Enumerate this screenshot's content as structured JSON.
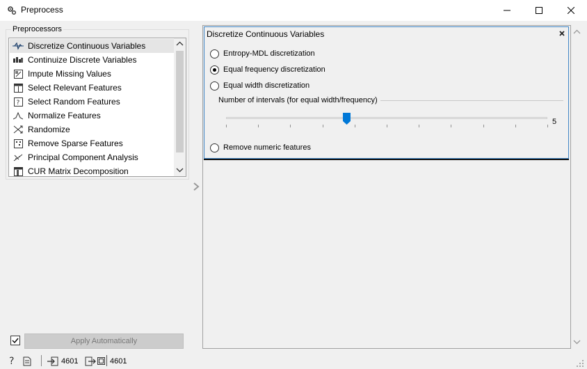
{
  "window": {
    "title": "Preprocess",
    "icon": "gears-icon"
  },
  "preprocessors": {
    "label": "Preprocessors",
    "items": [
      {
        "label": "Discretize Continuous Variables",
        "icon": "discretize-icon",
        "selected": true
      },
      {
        "label": "Continuize Discrete Variables",
        "icon": "continuize-icon"
      },
      {
        "label": "Impute Missing Values",
        "icon": "impute-icon"
      },
      {
        "label": "Select Relevant Features",
        "icon": "select-relevant-icon"
      },
      {
        "label": "Select Random Features",
        "icon": "select-random-icon"
      },
      {
        "label": "Normalize Features",
        "icon": "normalize-icon"
      },
      {
        "label": "Randomize",
        "icon": "randomize-icon"
      },
      {
        "label": "Remove Sparse Features",
        "icon": "remove-sparse-icon"
      },
      {
        "label": "Principal Component Analysis",
        "icon": "pca-icon"
      },
      {
        "label": "CUR Matrix Decomposition",
        "icon": "cur-icon"
      }
    ]
  },
  "discretize": {
    "title": "Discretize Continuous Variables",
    "options": [
      {
        "label": "Entropy-MDL discretization",
        "checked": false
      },
      {
        "label": "Equal frequency discretization",
        "checked": true
      },
      {
        "label": "Equal width discretization",
        "checked": false
      }
    ],
    "intervals_label": "Number of intervals (for equal width/frequency)",
    "intervals_value": "5",
    "slider_fraction": 0.375,
    "remove_label": "Remove numeric features"
  },
  "bottom": {
    "apply_label": "Apply Automatically",
    "auto_checked": true
  },
  "status": {
    "input_count": "4601",
    "output_count": "4601"
  },
  "colors": {
    "accent": "#0078d7",
    "frame": "#3f85c5"
  }
}
